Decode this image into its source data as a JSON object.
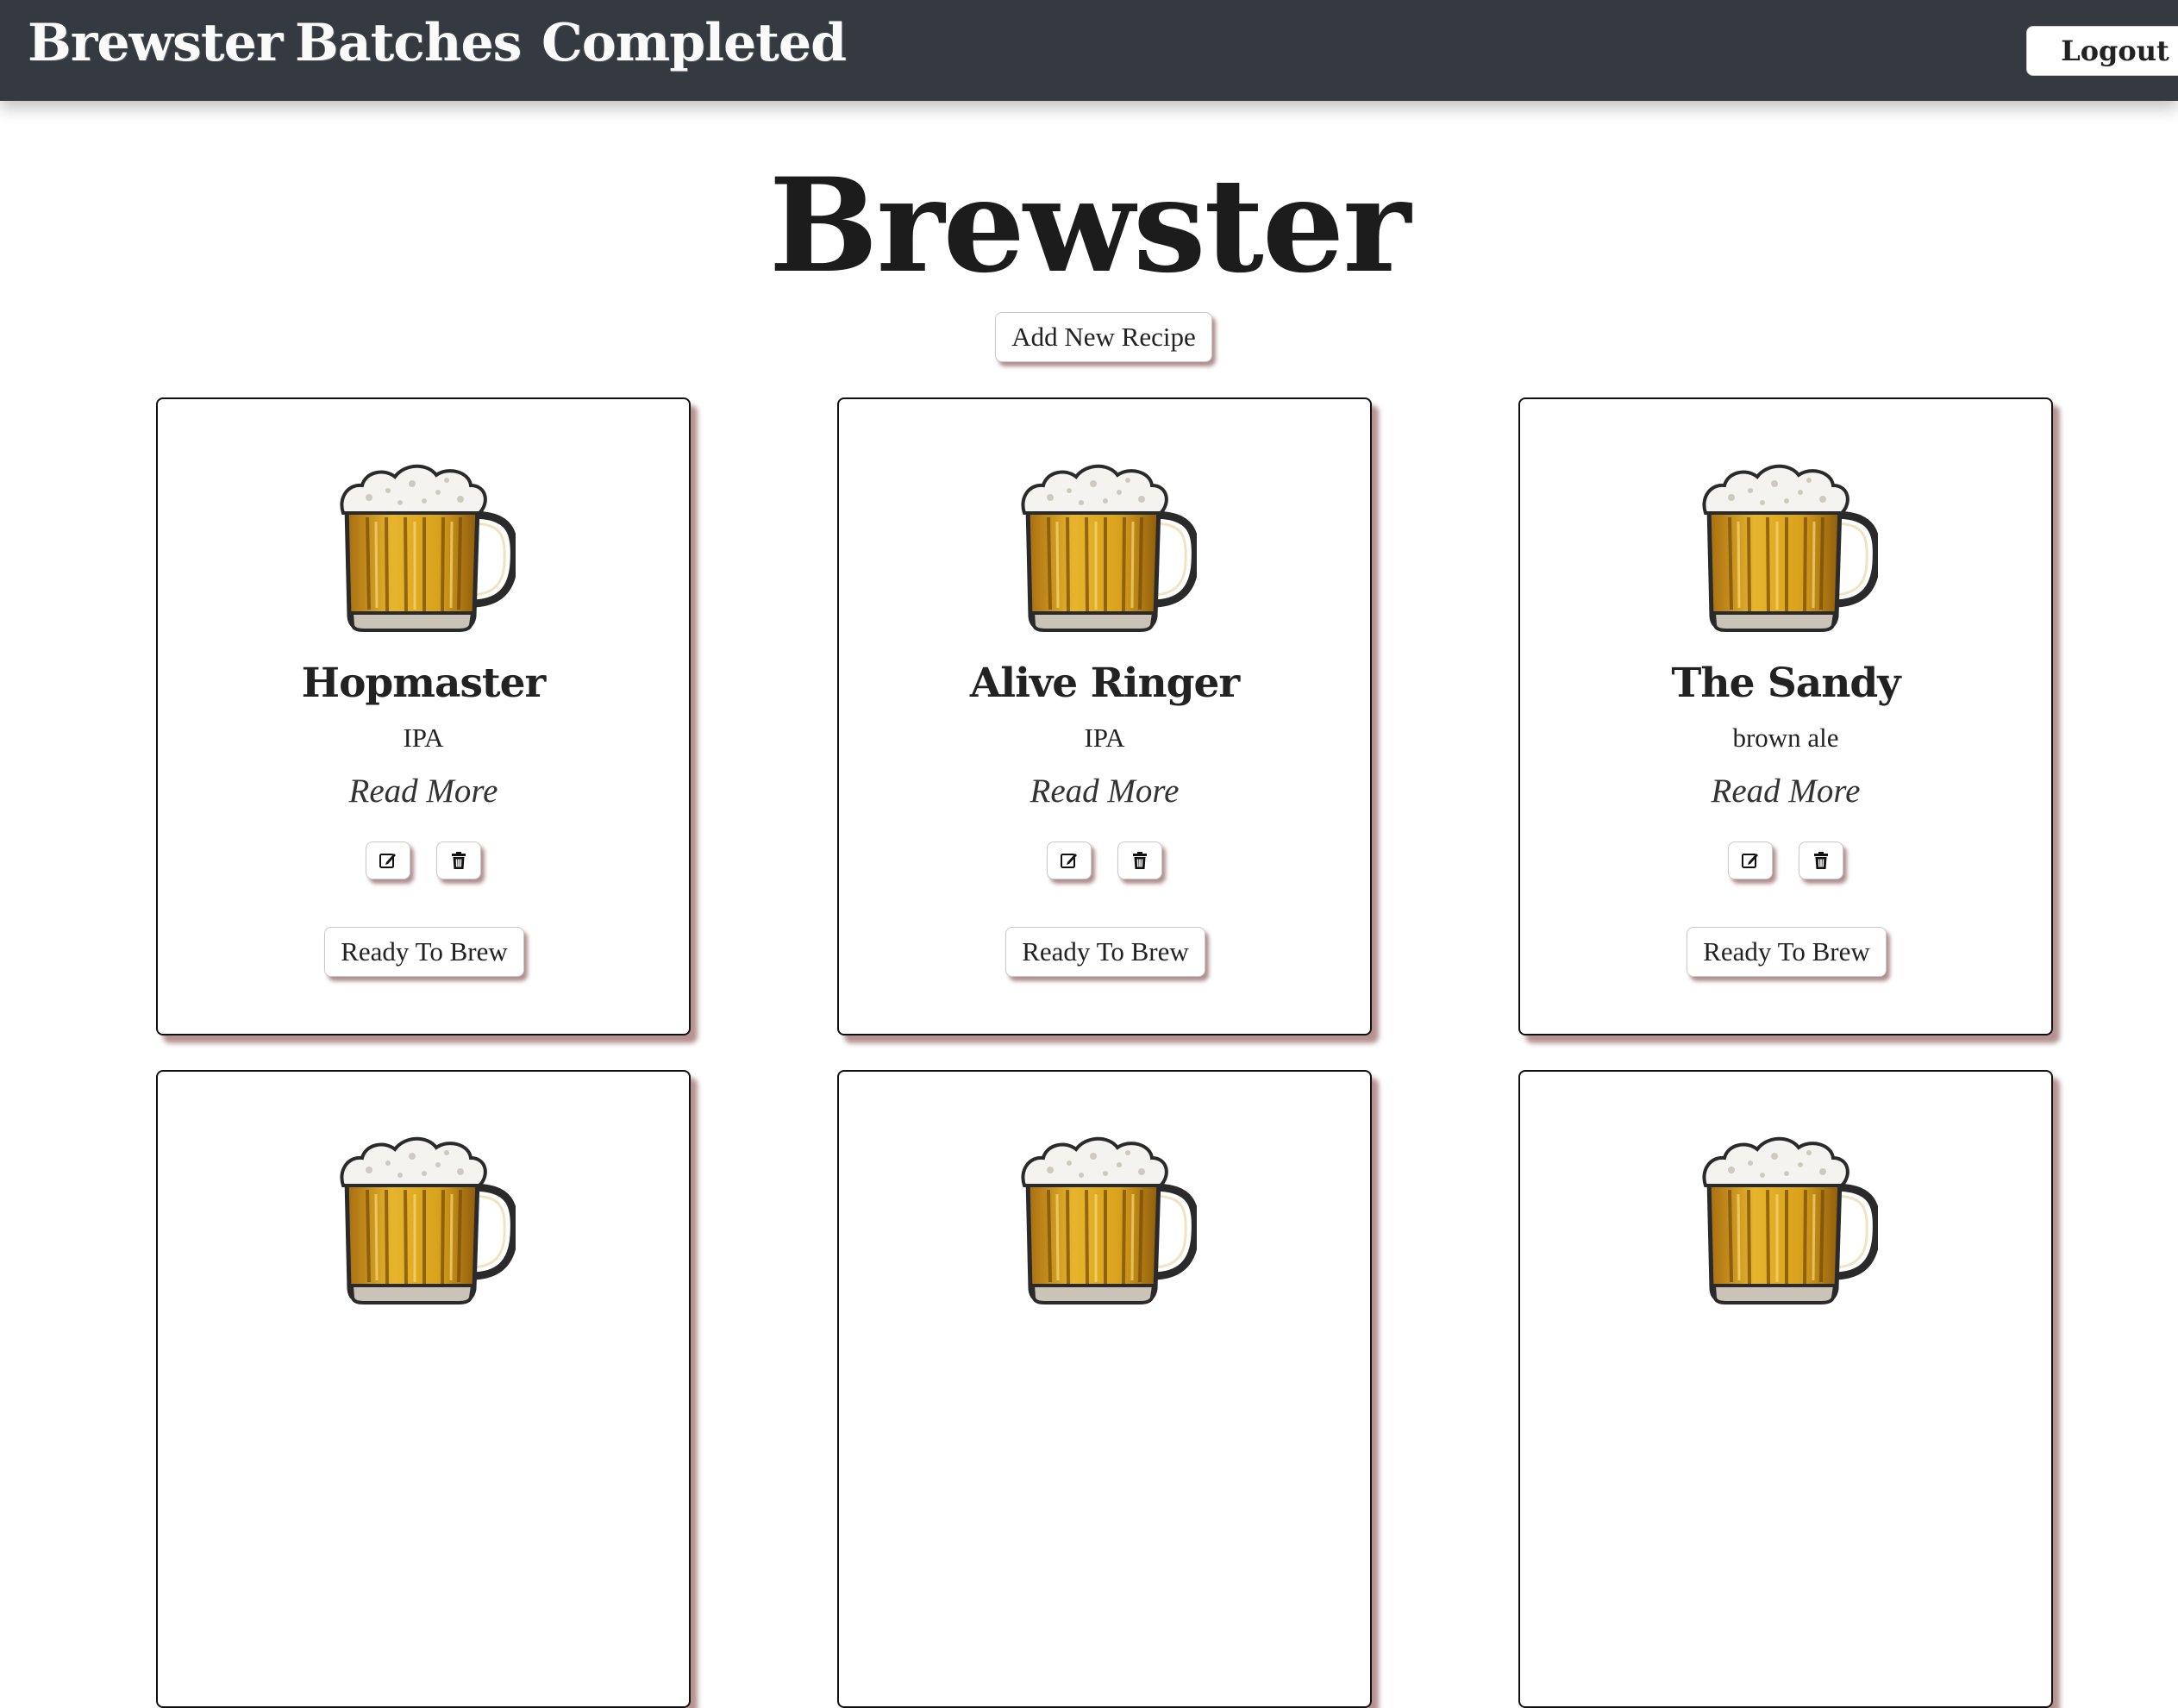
{
  "nav": {
    "brand": "Brewster",
    "links": [
      "Batches",
      "Completed"
    ],
    "logout_label": "Logout"
  },
  "page_title": "Brewster",
  "add_recipe_label": "Add New Recipe",
  "recipes": [
    {
      "name": "Hopmaster",
      "style": "IPA",
      "read_more": "Read More",
      "brew_label": "Ready To Brew",
      "image_icon": "beer-mug-icon"
    },
    {
      "name": "Alive Ringer",
      "style": "IPA",
      "read_more": "Read More",
      "brew_label": "Ready To Brew",
      "image_icon": "beer-mug-icon"
    },
    {
      "name": "The Sandy",
      "style": "brown ale",
      "read_more": "Read More",
      "brew_label": "Ready To Brew",
      "image_icon": "beer-mug-icon"
    },
    {
      "image_icon": "beer-mug-icon"
    },
    {
      "image_icon": "beer-mug-icon"
    },
    {
      "image_icon": "beer-mug-icon"
    }
  ],
  "icons": {
    "edit": "edit-icon",
    "delete": "trash-icon"
  },
  "colors": {
    "navbar": "#343a40",
    "card_shadow": "#7a3737",
    "beer": "#d9a21c"
  }
}
